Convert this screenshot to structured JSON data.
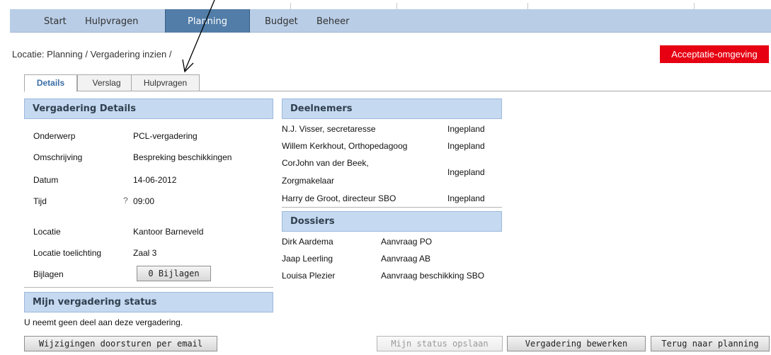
{
  "nav": {
    "items": [
      {
        "label": "Start",
        "active": false
      },
      {
        "label": "Hulpvragen",
        "active": false
      },
      {
        "label": "Planning",
        "active": true
      },
      {
        "label": "Budget",
        "active": false
      },
      {
        "label": "Beheer",
        "active": false
      }
    ]
  },
  "breadcrumb": "Locatie: Planning / Vergadering inzien /",
  "environment_badge": "Acceptatie-omgeving",
  "tabs": [
    {
      "label": "Details",
      "active": true
    },
    {
      "label": "Verslag",
      "active": false
    },
    {
      "label": "Hulpvragen",
      "active": false
    }
  ],
  "details": {
    "title": "Vergadering Details",
    "fields": [
      {
        "label": "Onderwerp",
        "value": "PCL-vergadering"
      },
      {
        "label": "Omschrijving",
        "value": "Bespreking beschikkingen"
      },
      {
        "label": "Datum",
        "value": "14-06-2012"
      },
      {
        "label": "Tijd",
        "value": "09:00",
        "hint": "?"
      },
      {
        "label": "Locatie",
        "value": "Kantoor Barneveld"
      },
      {
        "label": "Locatie toelichting",
        "value": "Zaal 3"
      }
    ],
    "attachments_label": "Bijlagen",
    "attachments_button": "0 Bijlagen"
  },
  "my_status": {
    "title": "Mijn vergadering status",
    "text": "U neemt geen deel aan deze vergadering."
  },
  "participants": {
    "title": "Deelnemers",
    "rows": [
      {
        "name": "N.J. Visser, secretaresse",
        "status": "Ingepland"
      },
      {
        "name": "Willem Kerkhout, Orthopedagoog",
        "status": "Ingepland"
      },
      {
        "name_line1": "CorJohn van der Beek,",
        "name_line2": "Zorgmakelaar",
        "status": "Ingepland"
      },
      {
        "name": "Harry de Groot, directeur SBO",
        "status": "Ingepland"
      }
    ]
  },
  "dossiers": {
    "title": "Dossiers",
    "rows": [
      {
        "name": "Dirk Aardema",
        "request": "Aanvraag PO"
      },
      {
        "name": "Jaap Leerling",
        "request": "Aanvraag AB"
      },
      {
        "name": "Louisa Plezier",
        "request": "Aanvraag beschikking SBO"
      }
    ]
  },
  "buttons": {
    "forward_email": "Wijzigingen doorsturen per email",
    "save_status": "Mijn status opslaan",
    "edit_meeting": "Vergadering bewerken",
    "back_to_planning": "Terug naar planning"
  },
  "colors": {
    "nav_bg": "#b9cde6",
    "nav_active": "#517da8",
    "section_header": "#c5d9f1",
    "badge": "#e60012"
  }
}
